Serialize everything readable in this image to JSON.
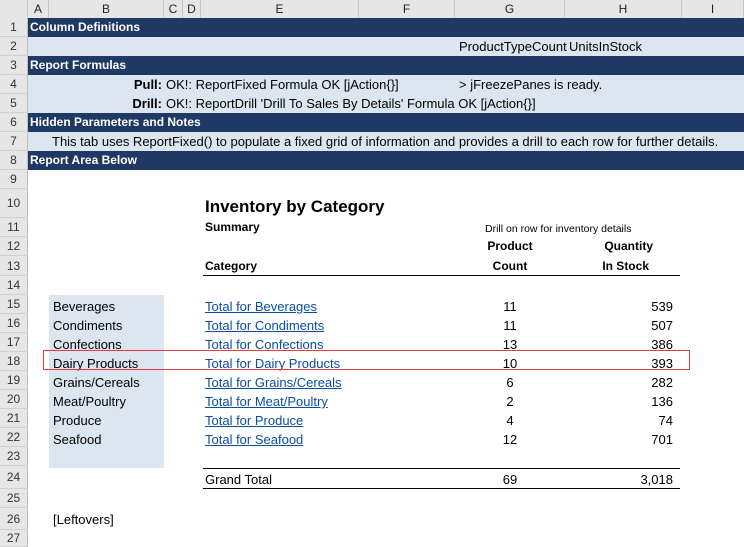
{
  "columns": [
    "A",
    "B",
    "C",
    "D",
    "E",
    "F",
    "G",
    "H",
    "I"
  ],
  "rows": [
    "1",
    "2",
    "3",
    "4",
    "5",
    "6",
    "7",
    "8",
    "9",
    "10",
    "11",
    "12",
    "13",
    "14",
    "15",
    "16",
    "17",
    "18",
    "19",
    "20",
    "21",
    "22",
    "23",
    "24",
    "25",
    "26",
    "27"
  ],
  "bands": {
    "column_definitions": "Column Definitions",
    "report_formulas": "Report Formulas",
    "hidden_parameters": "Hidden Parameters and Notes",
    "report_area": "Report Area Below"
  },
  "row2": {
    "col_g": "ProductTypeCount",
    "col_h": "UnitsInStock"
  },
  "formulas": {
    "pull_label": "Pull:",
    "pull_text": "OK!: ReportFixed Formula OK [jAction{}]",
    "pull_freeze": "> jFreezePanes is ready.",
    "drill_label": "Drill:",
    "drill_text": "OK!: ReportDrill 'Drill To Sales By Details' Formula OK [jAction{}]"
  },
  "note": "This tab uses ReportFixed() to populate a fixed grid of information and provides a drill to each row for further details.",
  "report": {
    "title": "Inventory by Category",
    "subtitle": "Summary",
    "drill_hint": "Drill on row for inventory details",
    "header_category": "Category",
    "header_count_1": "Product",
    "header_count_2": "Count",
    "header_qty_1": "Quantity",
    "header_qty_2": "In Stock",
    "items": [
      {
        "category": "Beverages",
        "link": "Total for Beverages",
        "count": "11",
        "qty": "539"
      },
      {
        "category": "Condiments",
        "link": "Total for Condiments",
        "count": "11",
        "qty": "507"
      },
      {
        "category": "Confections",
        "link": "Total for Confections",
        "count": "13",
        "qty": "386"
      },
      {
        "category": "Dairy Products",
        "link": "Total for Dairy Products",
        "count": "10",
        "qty": "393"
      },
      {
        "category": "Grains/Cereals",
        "link": "Total for Grains/Cereals",
        "count": "6",
        "qty": "282"
      },
      {
        "category": "Meat/Poultry",
        "link": "Total for Meat/Poultry",
        "count": "2",
        "qty": "136"
      },
      {
        "category": "Produce",
        "link": "Total for Produce",
        "count": "4",
        "qty": "74"
      },
      {
        "category": "Seafood",
        "link": "Total for Seafood",
        "count": "12",
        "qty": "701"
      }
    ],
    "grand_total_label": "Grand Total",
    "grand_total_count": "69",
    "grand_total_qty": "3,018",
    "leftovers": "[Leftovers]"
  }
}
